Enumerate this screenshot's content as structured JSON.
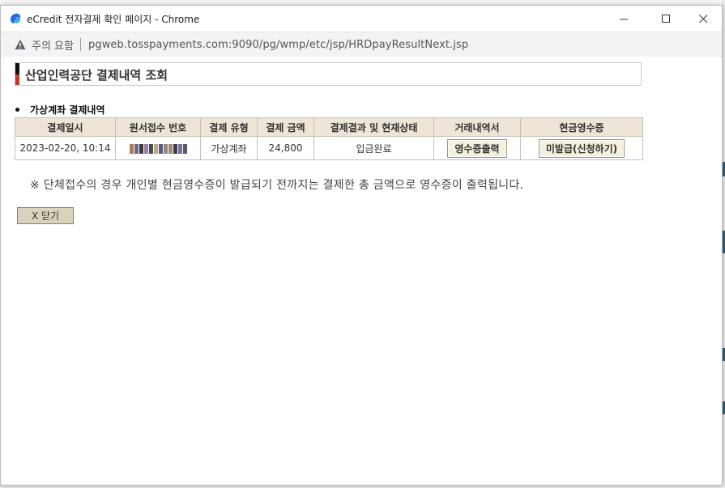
{
  "window": {
    "title": "eCredit 전자결제 확인 페이지 - Chrome",
    "minimize_symbol": "—",
    "maximize_symbol": "☐",
    "close_symbol": "✕"
  },
  "address": {
    "security_label": "주의 요함",
    "url": "pgweb.tosspayments.com:9090/pg/wmp/etc/jsp/HRDpayResultNext.jsp"
  },
  "page": {
    "title": "산업인력공단 결제내역 조회",
    "section_label": "가상계좌 결제내역",
    "columns": [
      "결제일시",
      "원서접수 번호",
      "결제 유형",
      "결제 금액",
      "결제결과 및 현재상태",
      "거래내역서",
      "현금영수증"
    ],
    "row": {
      "date": "2023-02-20, 10:14",
      "type": "가상계좌",
      "amount": "24,800",
      "status": "입금완료",
      "statement_button": "영수증출력",
      "cash_receipt_button": "미발급(신청하기)"
    },
    "notice": "※ 단체접수의 경우 개인별 현금영수증이 발급되기 전까지는 결제한 총 금액으로 영수증이 출력됩니다.",
    "close_button": "X 닫기"
  },
  "colors": {
    "header_bg": "#ece5d8",
    "button_bg": "#f4f0dc",
    "title_mark_top": "#111111",
    "title_mark_bottom": "#c0392b"
  }
}
